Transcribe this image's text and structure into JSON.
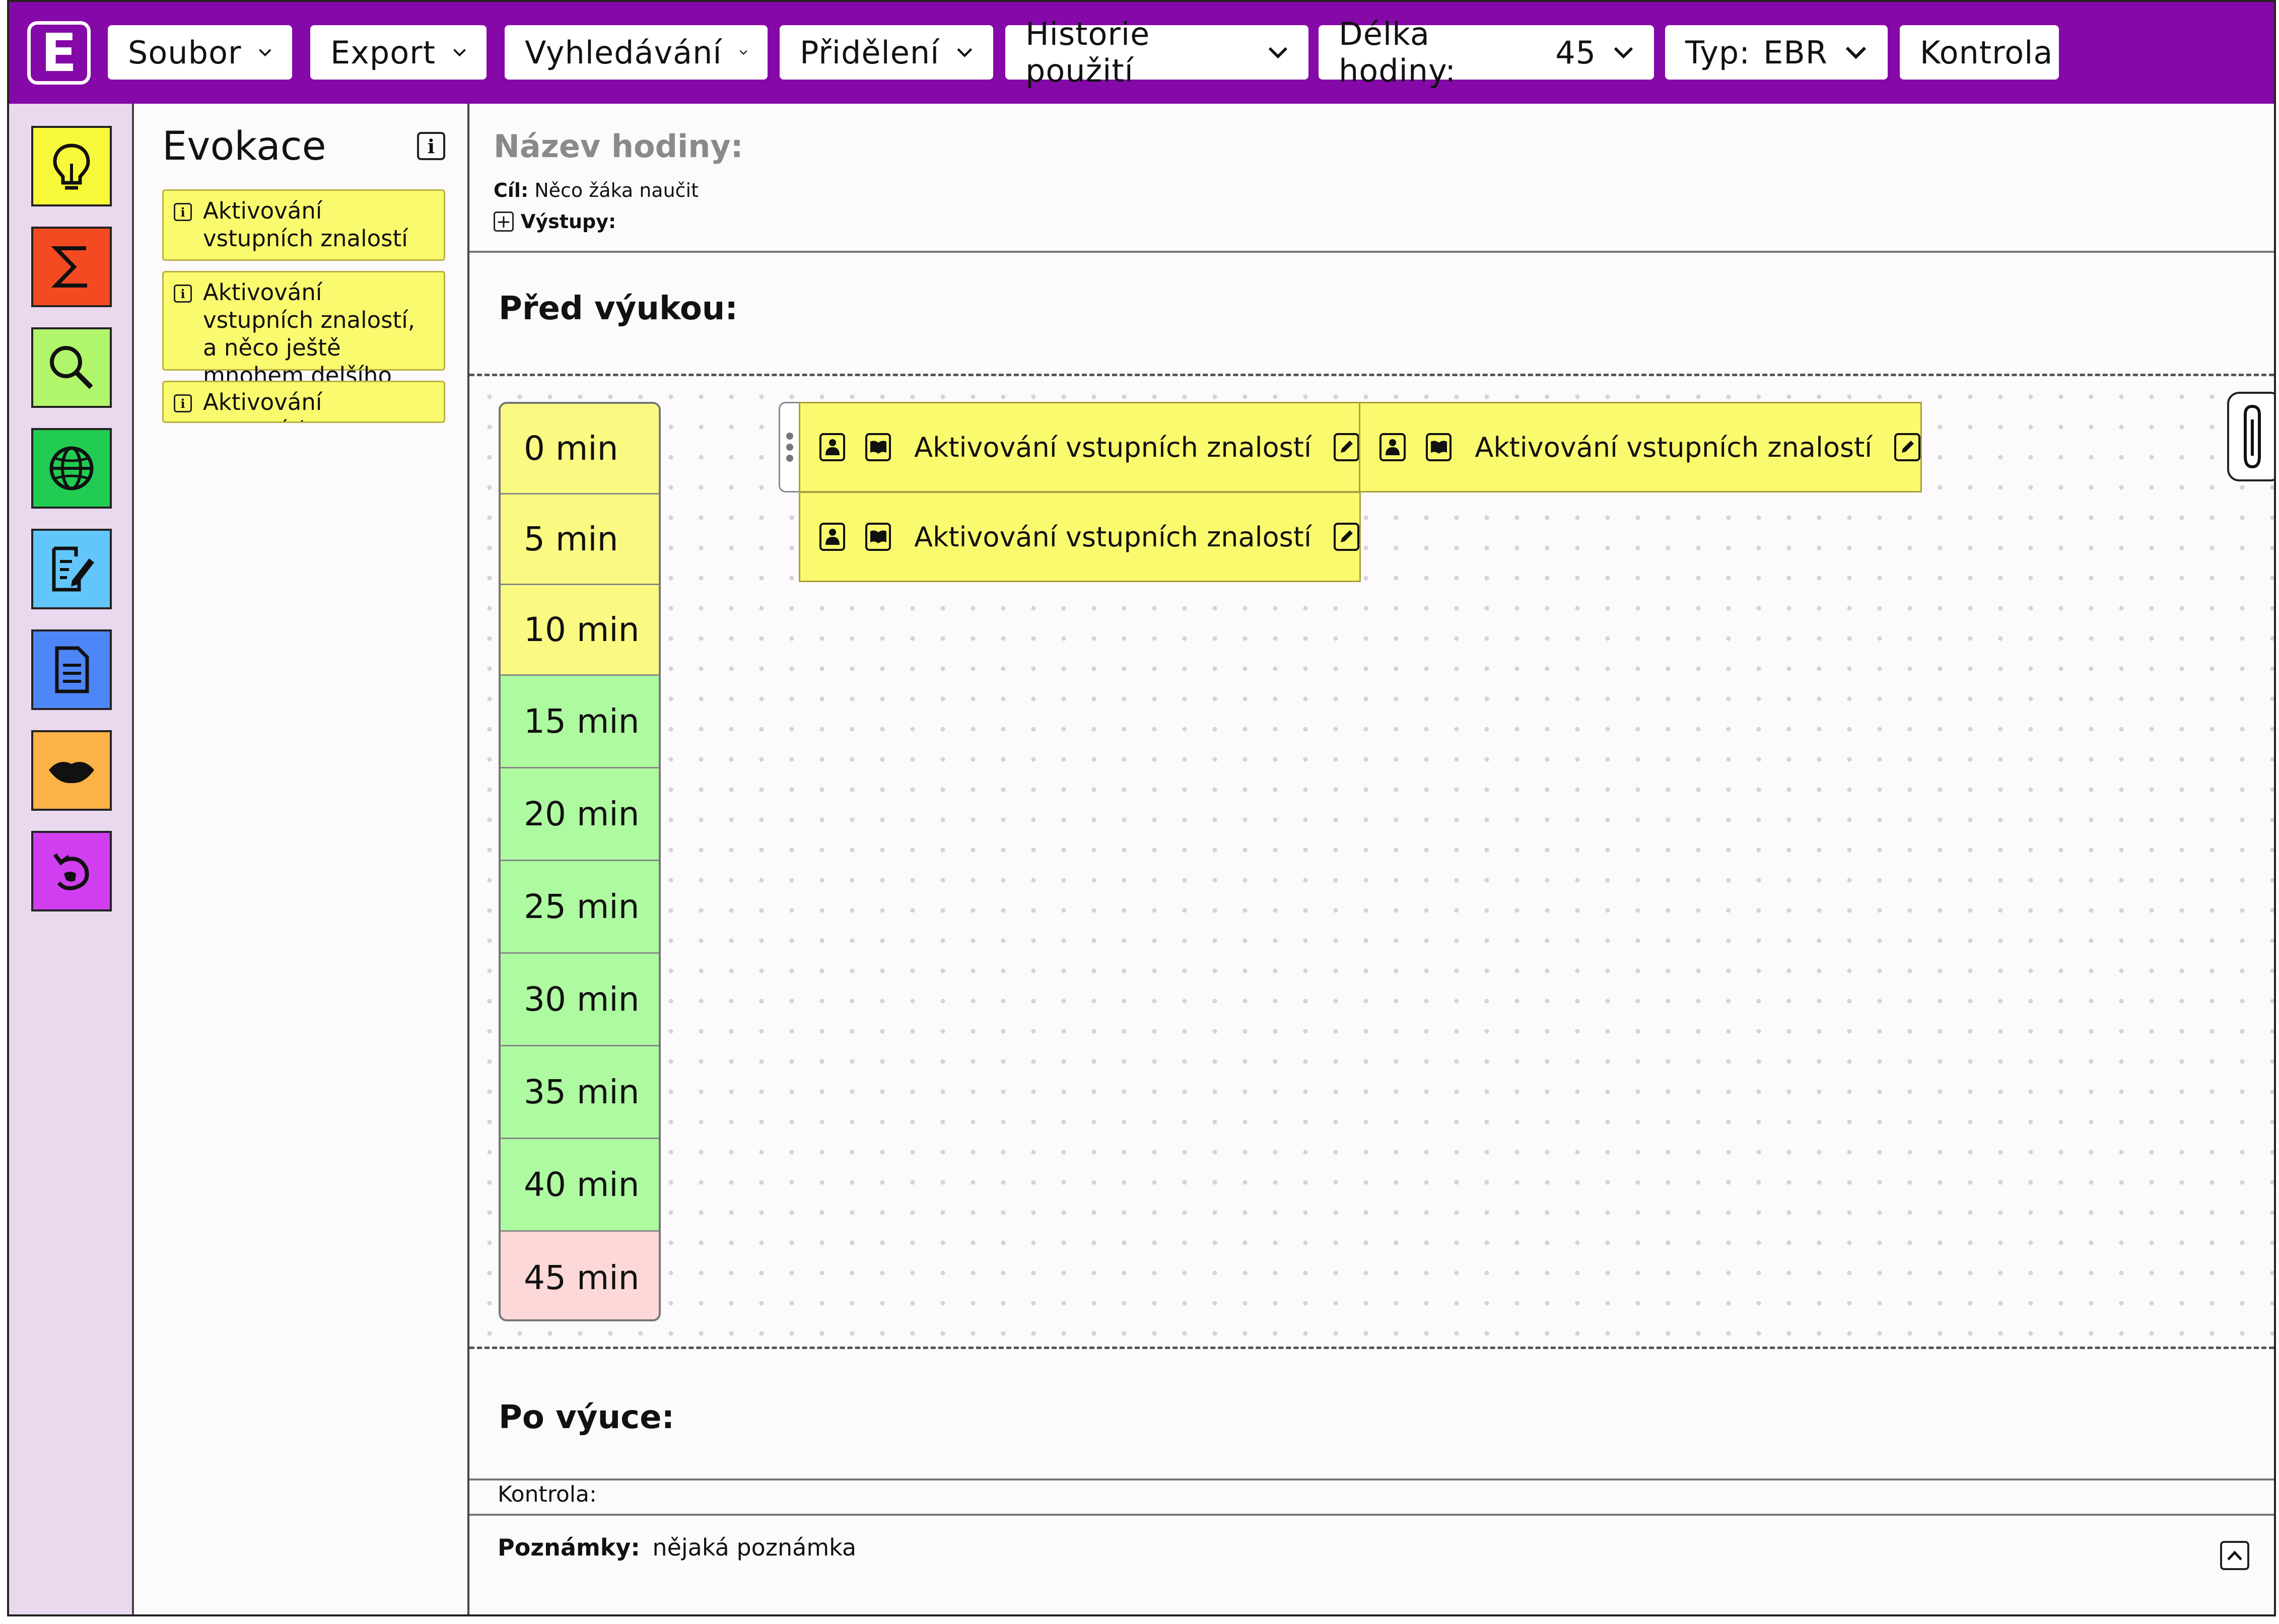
{
  "topbar": {
    "logo_letter": "E",
    "menus": {
      "file": "Soubor",
      "export": "Export",
      "search": "Vyhledávání",
      "assign": "Přidělení",
      "history": "Historie použití",
      "length_label": "Délka hodiny:",
      "length_value": "45",
      "type_label": "Typ:",
      "type_value": "EBR",
      "check": "Kontrola"
    },
    "color": "#8508a8"
  },
  "rail": {
    "items": [
      {
        "icon": "lightbulb-icon",
        "color": "#f8f83a"
      },
      {
        "icon": "sigma-icon",
        "color": "#f44a22"
      },
      {
        "icon": "magnifier-icon",
        "color": "#b0f56a"
      },
      {
        "icon": "globe-icon",
        "color": "#22cc52"
      },
      {
        "icon": "document-edit-icon",
        "color": "#62c6fa"
      },
      {
        "icon": "document-icon",
        "color": "#4f86f7"
      },
      {
        "icon": "lips-icon",
        "color": "#fbb246"
      },
      {
        "icon": "undo-hand-icon",
        "color": "#d03ef0"
      }
    ]
  },
  "panel": {
    "title": "Evokace",
    "info_glyph": "i",
    "cards": [
      {
        "label": "Aktivování vstupních znalostí"
      },
      {
        "label": "Aktivování vstupních znalostí, a něco ještě mnohem delšího"
      },
      {
        "label": "Aktivování vstupních"
      }
    ]
  },
  "main": {
    "lesson_name_label": "Název hodiny:",
    "goal_label": "Cíl:",
    "goal_value": "Něco žáka naučit",
    "outputs_label": "Výstupy:",
    "before_title": "Před výukou:",
    "after_title": "Po výuce:",
    "control_label": "Kontrola:",
    "notes_label": "Poznámky:",
    "notes_value": "nějaká poznámka"
  },
  "timeline": [
    {
      "label": "0 min",
      "color": "#fafa82"
    },
    {
      "label": "5 min",
      "color": "#fafa82"
    },
    {
      "label": "10 min",
      "color": "#fafa82"
    },
    {
      "label": "15 min",
      "color": "#aefaa0"
    },
    {
      "label": "20 min",
      "color": "#aefaa0"
    },
    {
      "label": "25 min",
      "color": "#aefaa0"
    },
    {
      "label": "30 min",
      "color": "#aefaa0"
    },
    {
      "label": "35 min",
      "color": "#aefaa0"
    },
    {
      "label": "40 min",
      "color": "#aefaa0"
    },
    {
      "label": "45 min",
      "color": "#fcd8d8"
    }
  ],
  "blocks": [
    {
      "label": "Aktivování vstupních znalostí"
    },
    {
      "label": "Aktivování vstupních znalostí"
    },
    {
      "label": "Aktivování vstupních znalostí"
    }
  ]
}
